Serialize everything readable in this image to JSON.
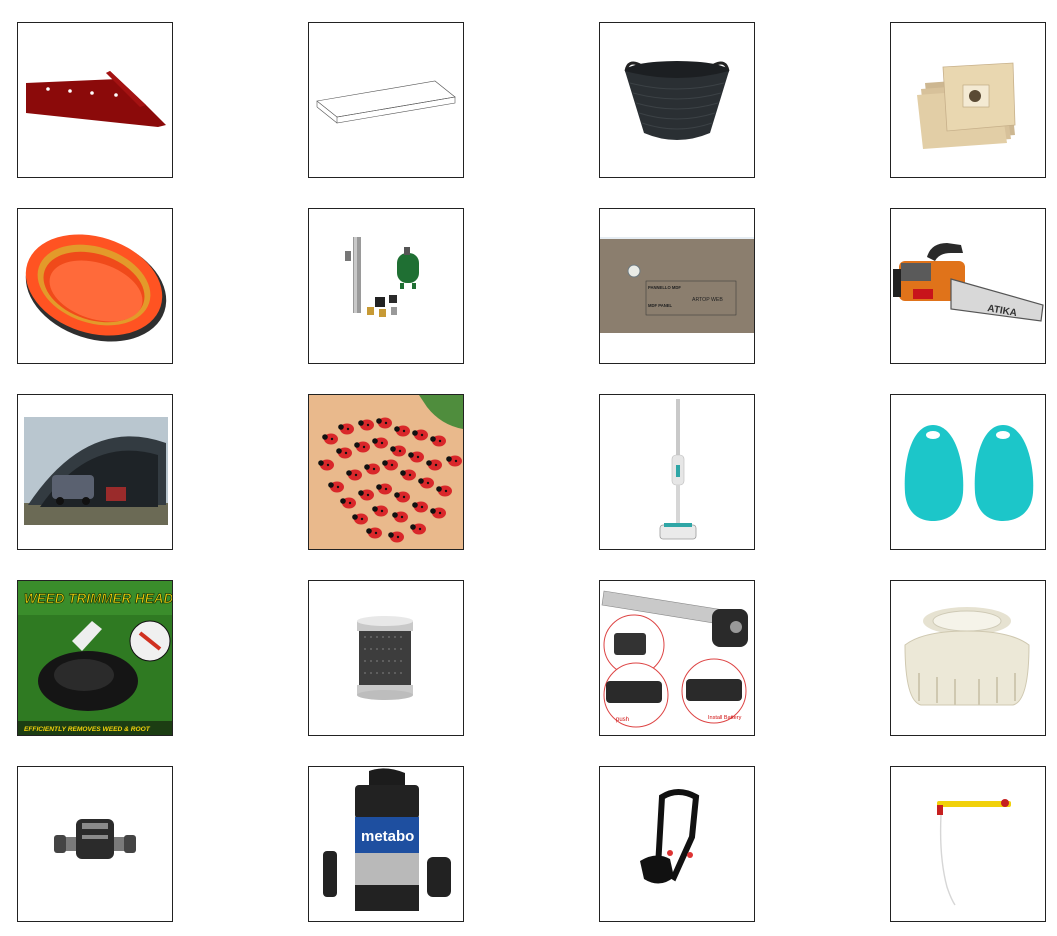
{
  "products": [
    {
      "id": "plough-blade-icon"
    },
    {
      "id": "shelf-board-icon"
    },
    {
      "id": "flexible-tub-icon"
    },
    {
      "id": "vacuum-bags-icon"
    },
    {
      "id": "air-filter-icon"
    },
    {
      "id": "pump-kit-icon"
    },
    {
      "id": "fibreboard-panel-icon",
      "label_lines": [
        "PANNELLO MDF",
        "MDF PANEL"
      ],
      "logo_text": "ARTOP WEB"
    },
    {
      "id": "chainsaw-icon",
      "brand": "ATIKA"
    },
    {
      "id": "carport-tent-icon"
    },
    {
      "id": "ladybug-decor-icon"
    },
    {
      "id": "steam-mop-icon"
    },
    {
      "id": "silicone-scrubbers-icon"
    },
    {
      "id": "trimmer-head-banner",
      "title_line": "WEED TRIMMER HEAD",
      "footer_line": "EFFICIENTLY REMOVES WEED & ROOT"
    },
    {
      "id": "carbon-filter-icon"
    },
    {
      "id": "digital-angle-ruler-icon",
      "callout_push": "push",
      "callout_battery": "Install Battery"
    },
    {
      "id": "tank-cap-icon"
    },
    {
      "id": "hose-t-connector-icon"
    },
    {
      "id": "submersible-pump-icon",
      "brand": "metabo"
    },
    {
      "id": "shoulder-harness-icon"
    },
    {
      "id": "hand-pump-sprayer-icon"
    }
  ],
  "colors": {
    "tile_border": "#222222",
    "plough_red": "#8b0a0a",
    "filter_orange": "#f04a1a",
    "turquoise": "#1cc6c9",
    "metabo_blue": "#1e4fa0"
  }
}
